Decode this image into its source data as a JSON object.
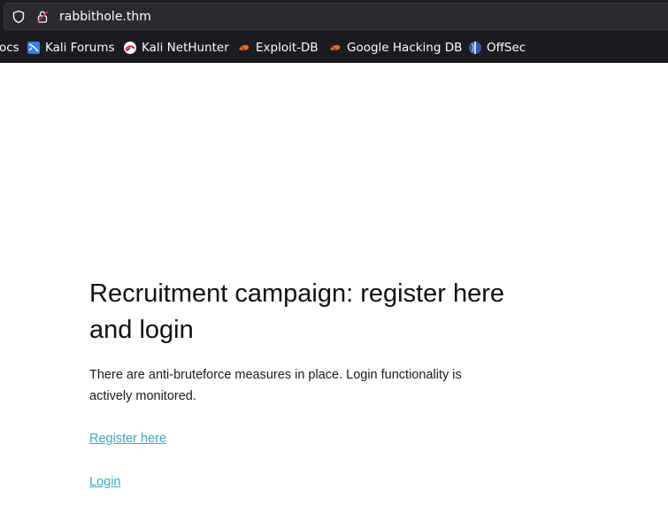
{
  "browser": {
    "url": "rabbithole.thm",
    "bookmarks": [
      {
        "label": "ocs",
        "icon": "document-icon"
      },
      {
        "label": "Kali Forums",
        "icon": "kali-forums-icon"
      },
      {
        "label": "Kali NetHunter",
        "icon": "kali-nethunter-icon"
      },
      {
        "label": "Exploit-DB",
        "icon": "exploit-db-icon"
      },
      {
        "label": "Google Hacking DB",
        "icon": "google-hacking-db-icon"
      },
      {
        "label": "OffSec",
        "icon": "offsec-icon"
      }
    ]
  },
  "page": {
    "title": "Recruitment campaign: register here and login",
    "description": "There are anti-bruteforce measures in place. Login functionality is actively monitored.",
    "register_link": "Register here",
    "login_link": "Login"
  },
  "colors": {
    "chrome_bg": "#1c1b22",
    "urlbar_bg": "#2b2a33",
    "link": "#3aa8c9"
  }
}
